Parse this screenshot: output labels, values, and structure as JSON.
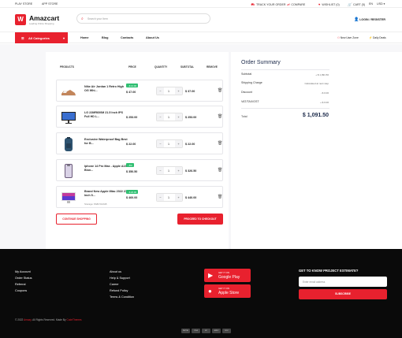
{
  "topbar": {
    "play_store": "PLAY STORE",
    "app_store": "APP STORE",
    "track": "TRACK YOUR ORDER",
    "compare": "COMPARE",
    "wishlist": "WISHLIST (0)",
    "cart": "CART (5)",
    "lang": "EN",
    "currency": "USD"
  },
  "header": {
    "logo_letter": "W",
    "brand": "Amazcart",
    "tagline": "Leading Online Shopping",
    "search_placeholder": "Search your Item",
    "login": "LOGIN / REGISTER"
  },
  "nav": {
    "all_categories": "All Categories",
    "links": [
      "Home",
      "Blog",
      "Contacts",
      "About Us"
    ],
    "new_user_zone": "New User Zone",
    "daily_deals": "Daily Deals"
  },
  "cart": {
    "headers": {
      "products": "PRODUCTS",
      "price": "PRICE",
      "quantity": "QUANTITY",
      "subtotal": "SUBTOTAL",
      "remove": "REMOVE"
    },
    "items": [
      {
        "name": "Nike Air Jordan 1 Retro High OG Whi...",
        "discount": "- $ 10.00",
        "price": "$ 47.00",
        "qty": "1",
        "subtotal": "$ 37.00",
        "stock": ""
      },
      {
        "name": "LG 22MR600M 21.5 Inch IPS Full HD L...",
        "discount": "",
        "price": "$ 253.00",
        "qty": "1",
        "subtotal": "$ 253.00",
        "stock": ""
      },
      {
        "name": "Exclusive Waterproof Bag Best for B...",
        "discount": "",
        "price": "$ 22.00",
        "qty": "1",
        "subtotal": "$ 22.00",
        "stock": ""
      },
      {
        "name": "Iphone 14 Pro Max - Apple A16 Bion...",
        "discount": "- 8%",
        "price": "$ 350.50",
        "qty": "1",
        "subtotal": "$ 326.50",
        "stock": ""
      },
      {
        "name": "Brand New Apple iMac 2022 27 Inch 5...",
        "discount": "- $ 20.00",
        "price": "$ 460.00",
        "qty": "1",
        "subtotal": "$ 440.00",
        "stock": "Storage: 8GB-512GB"
      }
    ],
    "continue": "CONTINUE SHOPPING",
    "checkout": "PROCEED TO CHECKOUT"
  },
  "summary": {
    "title": "Order Summary",
    "rows": [
      {
        "label": "Subtotal",
        "value": "+ $ 1,091.50"
      },
      {
        "label": "Shipping Charge",
        "value": "Calculated at next step"
      },
      {
        "label": "Discount",
        "value": "- $ 0.00"
      },
      {
        "label": "VAT/TAX/GST",
        "value": "+ $ 0.00"
      }
    ],
    "total_label": "Total",
    "total_value": "$ 1,091.50"
  },
  "footer": {
    "col1": [
      "My Account",
      "Order Status",
      "Referral",
      "Coupons"
    ],
    "col2": [
      "About us",
      "Help & Support",
      "Career",
      "Refund Policy",
      "Terms & Condition"
    ],
    "google_small": "GET IT ON",
    "google_big": "Google Play",
    "apple_small": "GET IT ON",
    "apple_big": "Apple Store",
    "newsletter_title": "GET TO KNOW PROJECT ESTIMATE?",
    "email_placeholder": "Enter email address",
    "subscribe": "SUBSCRIBE",
    "copyright_pre": "© 2022",
    "copyright_brand": "Amazy",
    "copyright_mid": ". All Rights Reserved. Made By",
    "copyright_maker": "CodeThemes",
    "payments": [
      "PAYPAL",
      "VISA",
      "MC",
      "AMEX",
      "DISC"
    ]
  },
  "colors": {
    "accent": "#e8212e",
    "green": "#2fbf71",
    "navy": "#1c2a4a"
  }
}
